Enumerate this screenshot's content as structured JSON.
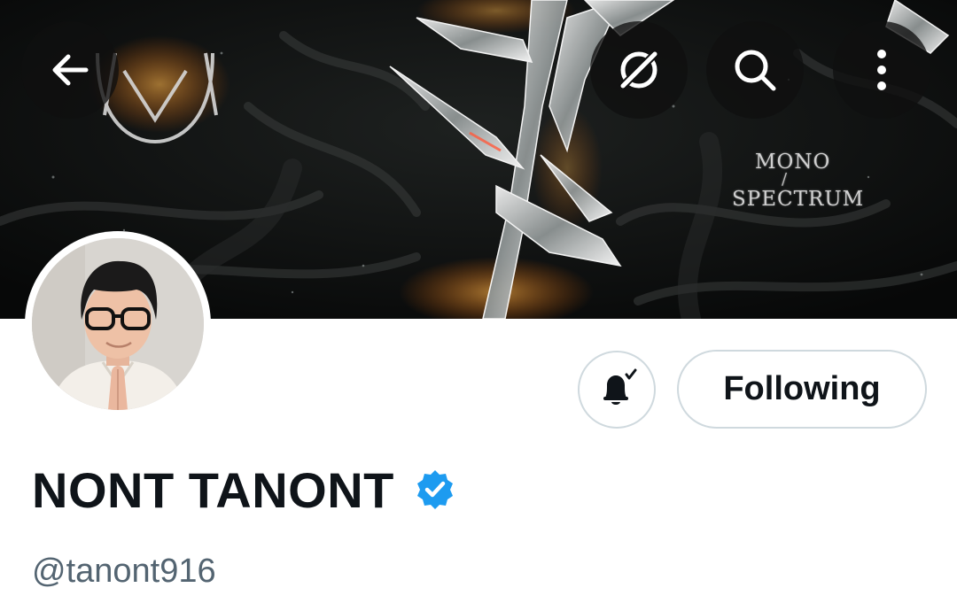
{
  "banner": {
    "art_text_top": "MONO",
    "art_text_slash": "/",
    "art_text_bottom": "SPECTRUM"
  },
  "top_bar": {
    "back_icon": "arrow-left-icon",
    "grok_icon": "grok-icon",
    "search_icon": "search-icon",
    "more_icon": "more-vertical-icon"
  },
  "profile": {
    "display_name": "NONT TANONT",
    "handle": "@tanont916",
    "verified": true,
    "verified_color": "#1d9bf0"
  },
  "actions": {
    "notify_icon": "bell-check-icon",
    "follow_label": "Following"
  },
  "colors": {
    "text_primary": "#0f1419",
    "text_secondary": "#536471",
    "border": "#cfd9de",
    "icon_button_bg": "#0f0f0f"
  }
}
